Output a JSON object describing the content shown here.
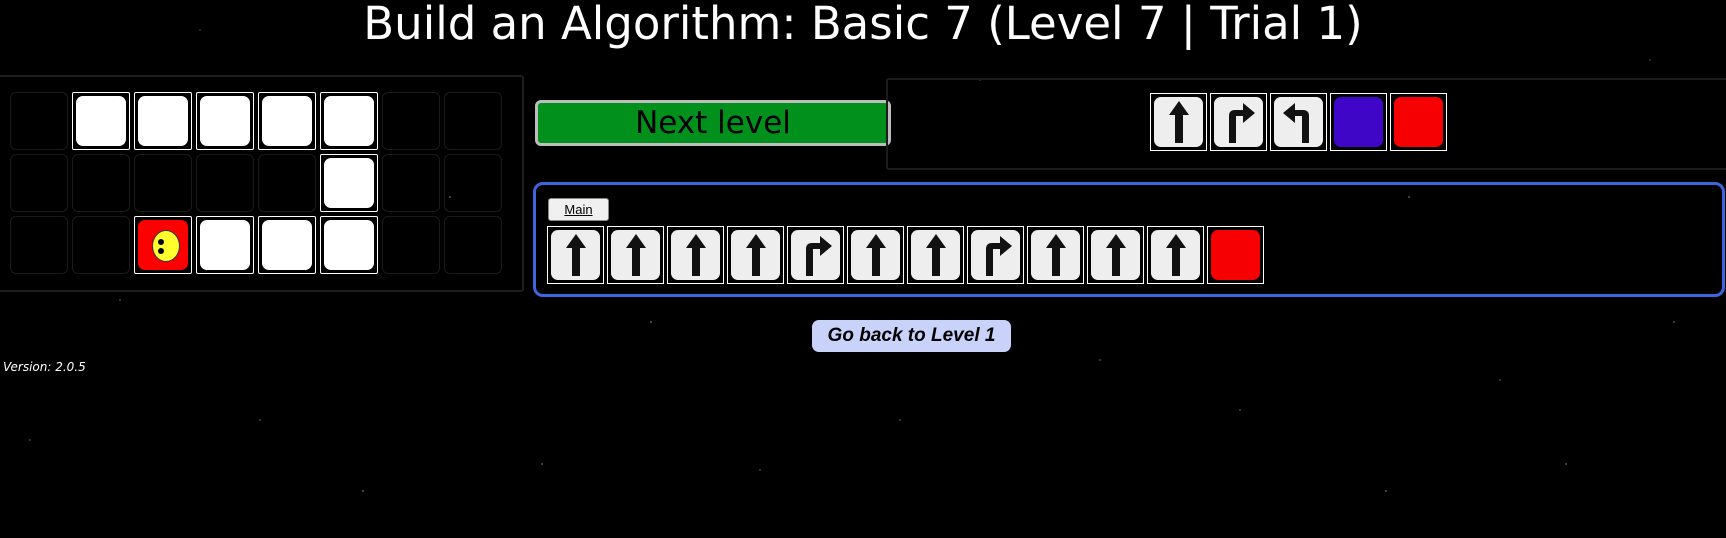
{
  "title": "Build an Algorithm: Basic 7 (Level 7 | Trial 1)",
  "grid": {
    "rows": 3,
    "cols": 8,
    "cells": [
      [
        "empty",
        "path",
        "path",
        "path",
        "path",
        "path",
        "empty",
        "empty"
      ],
      [
        "empty",
        "empty",
        "empty",
        "empty",
        "empty",
        "path",
        "empty",
        "empty"
      ],
      [
        "empty",
        "empty",
        "player",
        "path",
        "path",
        "path",
        "empty",
        "empty"
      ]
    ]
  },
  "next_level": {
    "label": "Next level"
  },
  "palette": {
    "blocks": [
      {
        "kind": "forward",
        "icon": "arrow-up-icon"
      },
      {
        "kind": "turn-right",
        "icon": "turn-right-icon"
      },
      {
        "kind": "turn-left",
        "icon": "turn-left-icon"
      },
      {
        "kind": "blue",
        "icon": "blue-block",
        "color": "#3f06c8"
      },
      {
        "kind": "red",
        "icon": "red-block",
        "color": "#f70004"
      }
    ]
  },
  "program": {
    "main_label": "Main",
    "steps": [
      "forward",
      "forward",
      "forward",
      "forward",
      "turn-right",
      "forward",
      "forward",
      "turn-right",
      "forward",
      "forward",
      "forward",
      "red"
    ]
  },
  "back_button": {
    "label": "Go back to Level 1"
  },
  "version": "Version: 2.0.5",
  "colors": {
    "accent_blue": "#3c65e0",
    "next_green": "#00901b",
    "back_button_bg": "#c9d3fa",
    "player_red": "#f70004",
    "face_yellow": "#ffff2e"
  }
}
